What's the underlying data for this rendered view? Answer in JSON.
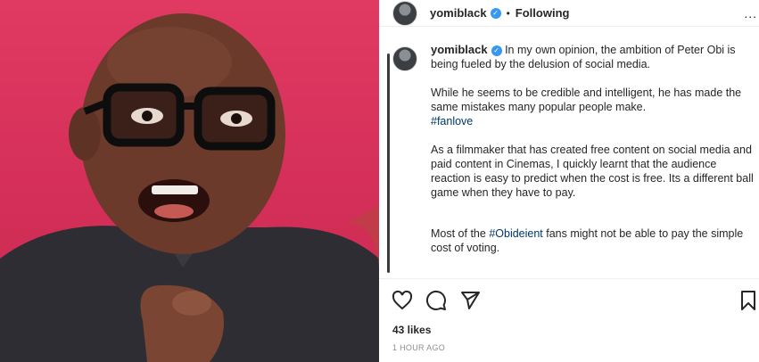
{
  "post": {
    "username": "yomiblack",
    "follow_status": "Following",
    "more_label": "...",
    "caption": {
      "p1": "In my own opinion, the ambition of Peter Obi is being fueled by the delusion of social media.",
      "p2": "While he seems to be credible and intelligent, he has made the same mistakes many popular people make.",
      "p2_tag": "#fanlove",
      "p3": "As a filmmaker that has created free content on social media and paid content in Cinemas, I quickly learnt that the audience reaction is easy to predict when the cost is free. Its a different ball game when they have to pay.",
      "p4_start": "Most of the ",
      "p4_tag": "#Obideient",
      "p4_end": " fans might not be able to pay the simple cost of voting."
    },
    "likes": "43 likes",
    "time": "1 HOUR AGO"
  },
  "icons": {
    "like": "heart-icon",
    "comment": "comment-icon",
    "share": "share-icon",
    "save": "bookmark-icon",
    "verified": "verified-badge-icon"
  },
  "colors": {
    "background_photo": "#d42f58",
    "verified": "#3897f0",
    "hashtag": "#00376b"
  }
}
